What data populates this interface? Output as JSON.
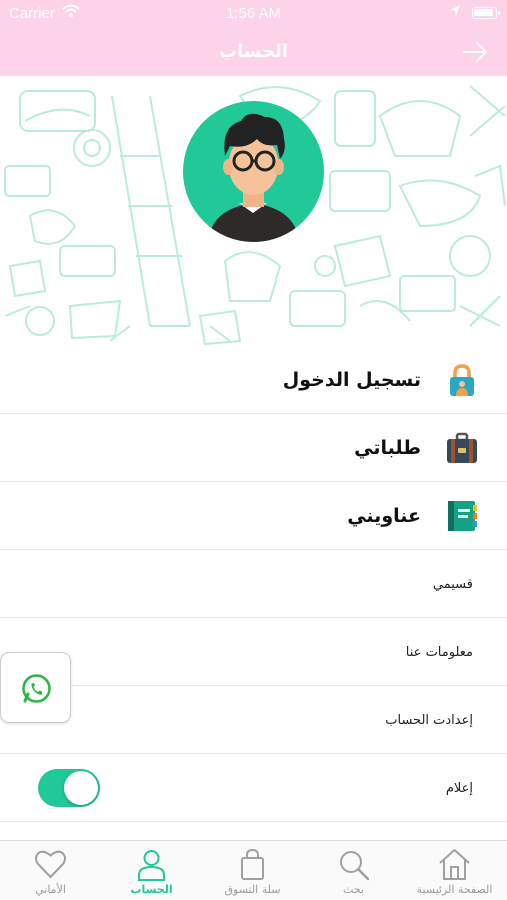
{
  "status_bar": {
    "carrier": "Carrier",
    "time": "1:56 AM"
  },
  "nav": {
    "title": "الحساب",
    "back_icon": "arrow-right-icon"
  },
  "colors": {
    "accent": "#20c997",
    "nav_bg": "#fcd3e8",
    "doodle": "#b9ecd9"
  },
  "profile": {
    "avatar_icon": "user-avatar"
  },
  "menu": {
    "login": {
      "label": "تسجيل الدخول",
      "icon": "lock-icon"
    },
    "orders": {
      "label": "طلباتي",
      "icon": "briefcase-icon"
    },
    "addresses": {
      "label": "عناويني",
      "icon": "address-book-icon"
    },
    "coupons": {
      "label": "قسيمي"
    },
    "about": {
      "label": "معلومات عنا"
    },
    "settings": {
      "label": "إعدادت الحساب"
    },
    "notifications": {
      "label": "إعلام",
      "toggle_on": true
    }
  },
  "whatsapp": {
    "icon": "whatsapp-icon"
  },
  "tabs": [
    {
      "label": "الأماني",
      "icon": "heart-icon"
    },
    {
      "label": "الحساب",
      "icon": "user-icon",
      "active": true
    },
    {
      "label": "سلة التسوق",
      "icon": "shopping-bag-icon"
    },
    {
      "label": "بحث",
      "icon": "search-icon"
    },
    {
      "label": "الصفحة الرئيسية",
      "icon": "home-icon"
    }
  ]
}
